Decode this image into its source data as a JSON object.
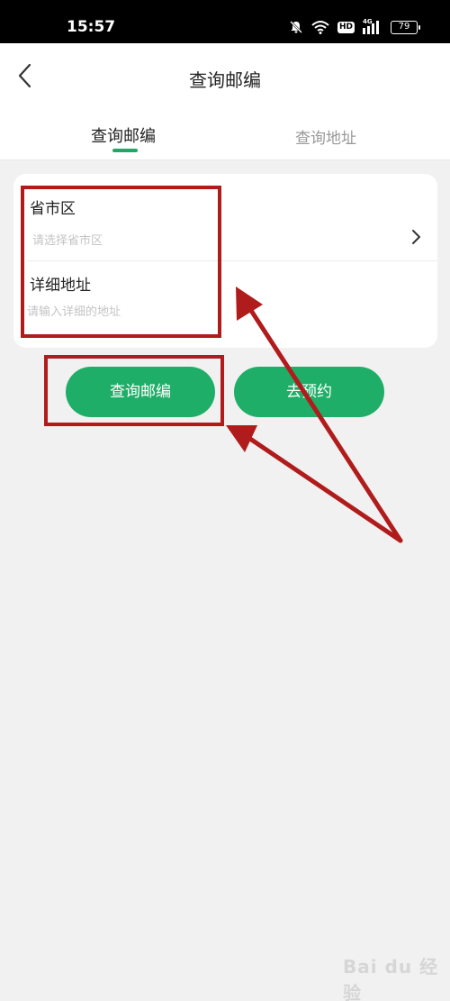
{
  "status_bar": {
    "time": "15:57",
    "hd_label": "HD",
    "network_label": "4G",
    "battery_level": "79",
    "icons": [
      "mute-icon",
      "wifi-icon",
      "hd-icon",
      "signal-icon",
      "battery-icon"
    ]
  },
  "header": {
    "title": "查询邮编",
    "back_icon": "chevron-left-icon"
  },
  "tabs": [
    {
      "label": "查询邮编",
      "active": true
    },
    {
      "label": "查询地址",
      "active": false
    }
  ],
  "form": {
    "region": {
      "label": "省市区",
      "placeholder": "请选择省市区"
    },
    "detail": {
      "label": "详细地址",
      "placeholder": "请输入详细的地址"
    }
  },
  "buttons": {
    "query": "查询邮编",
    "book": "去预约"
  },
  "colors": {
    "accent": "#1fae68",
    "annotation": "#b01c1c",
    "status_bar": "#000000",
    "background": "#f1f1f1"
  },
  "watermark": {
    "text": "Bai du 经验"
  }
}
